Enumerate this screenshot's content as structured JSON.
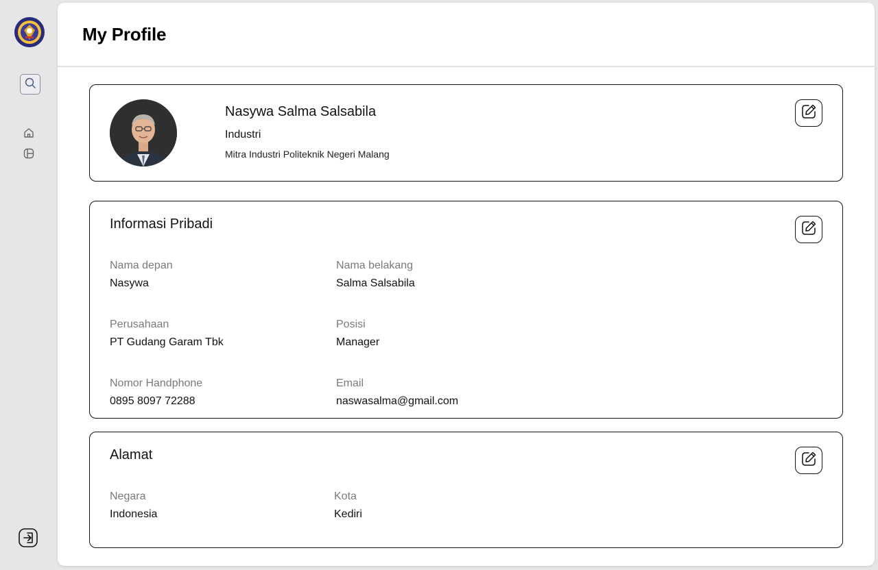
{
  "header": {
    "title": "My Profile"
  },
  "sidebar": {
    "logo_icon": "institution-logo-icon",
    "items": [
      {
        "icon": "search-icon"
      },
      {
        "icon": "home-icon"
      },
      {
        "icon": "layout-icon"
      }
    ],
    "logout_icon": "logout-icon"
  },
  "profile": {
    "name": "Nasywa Salma Salsabila",
    "role": "Industri",
    "organization": "Mitra Industri Politeknik Negeri Malang",
    "edit_icon": "edit-icon"
  },
  "personal": {
    "title": "Informasi Pribadi",
    "first_name_label": "Nama depan",
    "first_name": "Nasywa",
    "last_name_label": "Nama belakang",
    "last_name": "Salma Salsabila",
    "company_label": "Perusahaan",
    "company": "PT Gudang Garam Tbk",
    "position_label": "Posisi",
    "position": "Manager",
    "phone_label": "Nomor Handphone",
    "phone": "0895 8097 72288",
    "email_label": "Email",
    "email": "naswasalma@gmail.com"
  },
  "address": {
    "title": "Alamat",
    "country_label": "Negara",
    "country": "Indonesia",
    "city_label": "Kota",
    "city": "Kediri"
  },
  "colors": {
    "background": "#e6e6e6",
    "panel": "#ffffff",
    "border": "#111111",
    "muted_text": "#7a7a7a",
    "logo_blue": "#2a2a7a",
    "logo_gold": "#e3a126"
  }
}
